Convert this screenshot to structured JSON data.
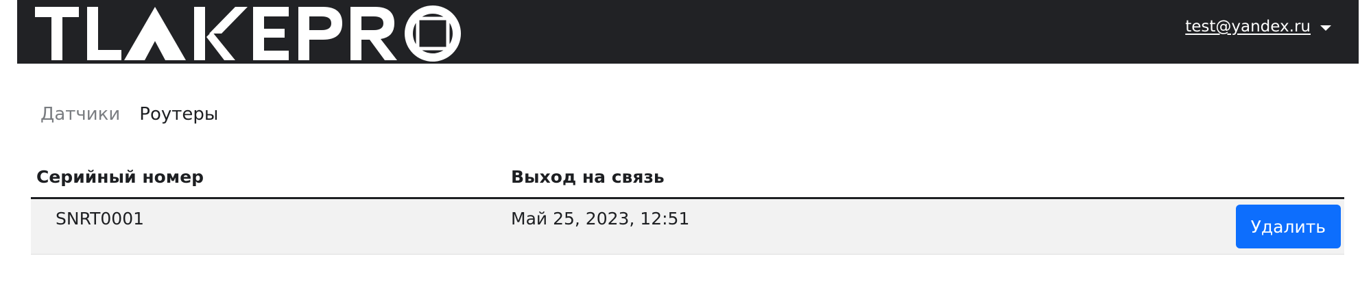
{
  "header": {
    "brand": "TLAKEPRO",
    "user_email": "test@yandex.ru"
  },
  "tabs": [
    {
      "label": "Датчики",
      "active": false
    },
    {
      "label": "Роутеры",
      "active": true
    }
  ],
  "table": {
    "columns": [
      "Серийный номер",
      "Выход на связь"
    ],
    "rows": [
      {
        "serial": "SNRT0001",
        "last_seen": "Май 25, 2023, 12:51",
        "delete_label": "Удалить"
      }
    ]
  },
  "colors": {
    "header_bg": "#212225",
    "accent": "#0d6efd",
    "row_bg": "#f2f2f2"
  }
}
